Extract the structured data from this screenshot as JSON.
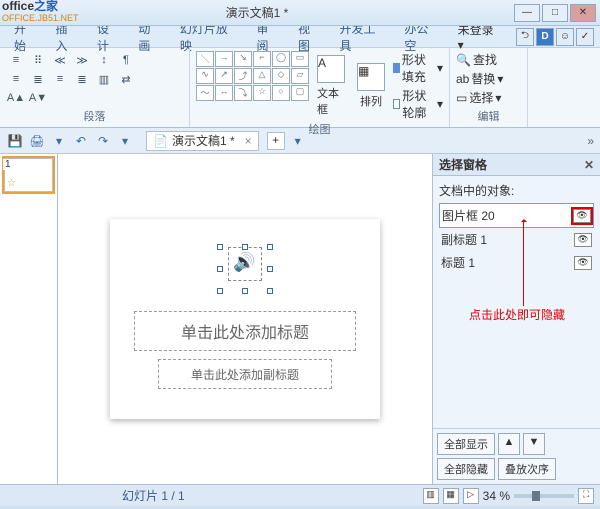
{
  "window": {
    "title": "演示文稿1 *"
  },
  "watermark": {
    "line1a": "office",
    "line1b": "之家",
    "line2": "OFFICE.JB51.NET"
  },
  "winctrl": {
    "min": "—",
    "max": "□",
    "close": "✕"
  },
  "menu": {
    "items": [
      "开始",
      "插入",
      "设计",
      "动画",
      "幻灯片放映",
      "审阅",
      "视图",
      "开发工具",
      "办公空"
    ],
    "notlogged": "未登录",
    "caret": "▾"
  },
  "menuicons": {
    "a": "⮌",
    "d": "D",
    "b": "☺",
    "c": "✓"
  },
  "ribbon": {
    "group_para": "段落",
    "group_draw": "绘图",
    "group_edit": "编辑",
    "textbox": "文本框",
    "arrange": "排列",
    "fill": "形状填充",
    "outline": "形状轮廓",
    "find": "查找",
    "replace": "替换",
    "select": "选择",
    "caret": "▾"
  },
  "qat": {
    "save": "💾",
    "print": "🖨",
    "undo": "↶",
    "redo": "↷",
    "caret": "▾",
    "doc_icon": "📄",
    "plus": "+",
    "chev": "»"
  },
  "doc": {
    "tab_title": "演示文稿1 *"
  },
  "thumbs": {
    "n1": "1",
    "star": "☆"
  },
  "slide": {
    "title_ph": "单击此处添加标题",
    "subtitle_ph": "单击此处添加副标题"
  },
  "panel": {
    "title": "选择窗格",
    "close": "✕",
    "label": "文档中的对象:",
    "items": [
      {
        "name": "图片框 20"
      },
      {
        "name": "副标题 1"
      },
      {
        "name": "标题 1"
      }
    ],
    "eye": "👁",
    "annotation": "点击此处即可隐藏",
    "show_all": "全部显示",
    "hide_all": "全部隐藏",
    "reorder": "叠放次序",
    "up": "▲",
    "down": "▼"
  },
  "status": {
    "slide_info": "幻灯片 1 / 1",
    "zoom_val": "34 %",
    "play": "▷",
    "fit": "⛶"
  }
}
